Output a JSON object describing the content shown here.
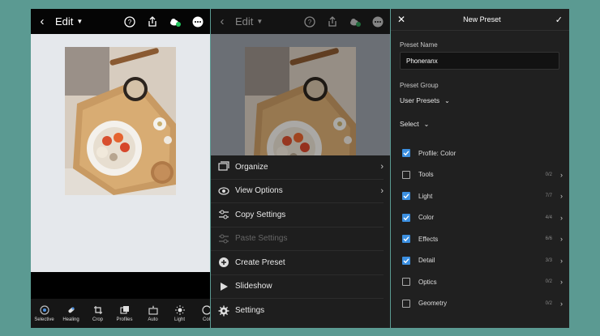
{
  "colors": {
    "background": "#5b9a92",
    "accent": "#3b8fe0"
  },
  "left": {
    "title": "Edit",
    "tools": [
      {
        "label": "Selective",
        "icon": "selective-icon"
      },
      {
        "label": "Healing",
        "icon": "healing-icon"
      },
      {
        "label": "Crop",
        "icon": "crop-icon"
      },
      {
        "label": "Profiles",
        "icon": "profiles-icon"
      },
      {
        "label": "Auto",
        "icon": "auto-icon"
      },
      {
        "label": "Light",
        "icon": "light-icon"
      },
      {
        "label": "Col",
        "icon": "color-icon"
      }
    ]
  },
  "middle": {
    "title": "Edit",
    "menu": [
      {
        "label": "Organize",
        "icon": "organize-icon",
        "chevron": "›",
        "enabled": true
      },
      {
        "label": "View Options",
        "icon": "view-options-icon",
        "chevron": "›",
        "enabled": true
      },
      {
        "label": "Copy Settings",
        "icon": "copy-settings-icon",
        "chevron": "",
        "enabled": true
      },
      {
        "label": "Paste Settings",
        "icon": "paste-settings-icon",
        "chevron": "",
        "enabled": false
      },
      {
        "label": "Create Preset",
        "icon": "create-preset-icon",
        "chevron": "",
        "enabled": true
      },
      {
        "label": "Slideshow",
        "icon": "slideshow-icon",
        "chevron": "",
        "enabled": true
      },
      {
        "label": "Settings",
        "icon": "settings-icon",
        "chevron": "",
        "enabled": true
      }
    ]
  },
  "right": {
    "title": "New Preset",
    "preset_name_label": "Preset Name",
    "preset_name_value": "Phoneranx",
    "preset_group_label": "Preset Group",
    "preset_group_value": "User Presets",
    "select_label": "Select",
    "options": [
      {
        "label": "Profile: Color",
        "checked": true,
        "count": "",
        "chevron": false
      },
      {
        "label": "Tools",
        "checked": false,
        "count": "0/2",
        "chevron": true
      },
      {
        "label": "Light",
        "checked": true,
        "count": "7/7",
        "chevron": true
      },
      {
        "label": "Color",
        "checked": true,
        "count": "4/4",
        "chevron": true
      },
      {
        "label": "Effects",
        "checked": true,
        "count": "6/6",
        "chevron": true
      },
      {
        "label": "Detail",
        "checked": true,
        "count": "3/3",
        "chevron": true
      },
      {
        "label": "Optics",
        "checked": false,
        "count": "0/2",
        "chevron": true
      },
      {
        "label": "Geometry",
        "checked": false,
        "count": "0/2",
        "chevron": true
      }
    ]
  }
}
